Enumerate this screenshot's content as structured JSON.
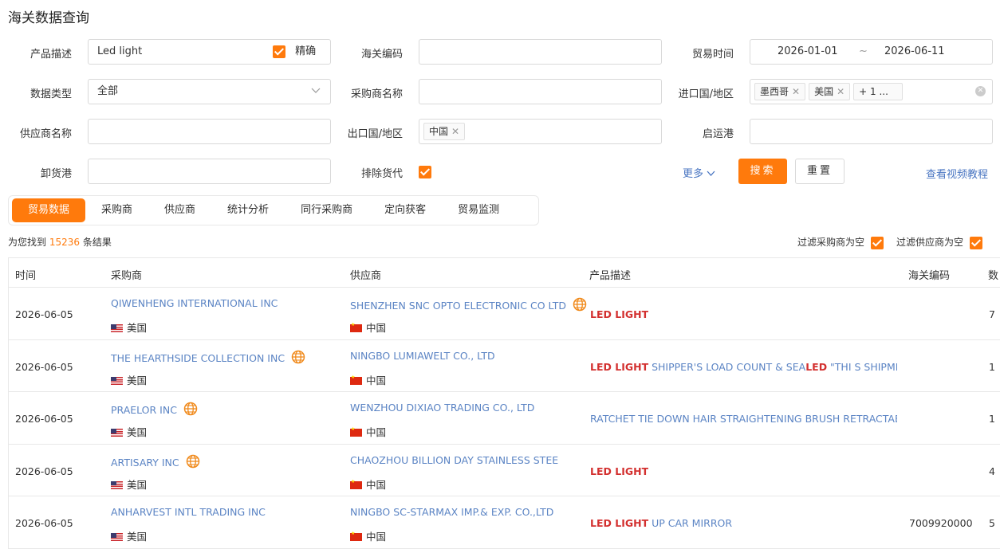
{
  "page_title": "海关数据查询",
  "form": {
    "product_desc": {
      "label": "产品描述",
      "value": "Led light",
      "exact_label": "精确"
    },
    "hs_code": {
      "label": "海关编码",
      "value": ""
    },
    "trade_time": {
      "label": "贸易时间",
      "start": "2026-01-01",
      "separator": "~",
      "end": "2026-06-11"
    },
    "data_type": {
      "label": "数据类型",
      "value": "全部"
    },
    "buyer_name": {
      "label": "采购商名称",
      "value": ""
    },
    "import_country": {
      "label": "进口国/地区",
      "tags": [
        "墨西哥",
        "美国"
      ],
      "more": "+ 1 ..."
    },
    "supplier_name": {
      "label": "供应商名称",
      "value": ""
    },
    "export_country": {
      "label": "出口国/地区",
      "tags": [
        "中国"
      ]
    },
    "origin_port": {
      "label": "启运港",
      "value": ""
    },
    "discharge_port": {
      "label": "卸货港",
      "value": ""
    },
    "exclude_forwarder": {
      "label": "排除货代"
    },
    "more_label": "更多",
    "search_label": "搜索",
    "reset_label": "重置",
    "video_tutorial": "查看视频教程"
  },
  "tabs": [
    "贸易数据",
    "采购商",
    "供应商",
    "统计分析",
    "同行采购商",
    "定向获客",
    "贸易监测"
  ],
  "result": {
    "prefix": "为您找到",
    "count": "15236",
    "suffix": "条结果"
  },
  "filters": {
    "buyer_empty": "过滤采购商为空",
    "supplier_empty": "过滤供应商为空"
  },
  "table": {
    "headers": {
      "time": "时间",
      "buyer": "采购商",
      "supplier": "供应商",
      "desc": "产品描述",
      "hs": "海关编码",
      "extra": "数"
    },
    "rows": [
      {
        "date": "2026-06-05",
        "buyer": "QIWENHENG INTERNATIONAL INC",
        "buyer_country": "美国",
        "buyer_globe": false,
        "supplier": "SHENZHEN SNC OPTO ELECTRONIC CO LTD",
        "supplier_country": "中国",
        "supplier_globe": true,
        "desc_hl": "LED LIGHT",
        "desc_rest": "",
        "hs": "",
        "qty": "7"
      },
      {
        "date": "2026-06-05",
        "buyer": "THE HEARTHSIDE COLLECTION INC",
        "buyer_country": "美国",
        "buyer_globe": true,
        "supplier": "NINGBO LUMIAWELT CO., LTD",
        "supplier_country": "中国",
        "supplier_globe": false,
        "desc_hl": "LED LIGHT",
        "desc_rest": " SHIPPER'S LOAD COUNT & SEA",
        "desc_hl2": "LED",
        "desc_rest2": " \"THI S SHIPMENT...",
        "hs": "",
        "qty": "1"
      },
      {
        "date": "2026-06-05",
        "buyer": "PRAELOR INC",
        "buyer_country": "美国",
        "buyer_globe": true,
        "supplier": "WENZHOU DIXIAO TRADING CO., LTD",
        "supplier_country": "中国",
        "supplier_globe": false,
        "desc_hl": "",
        "desc_rest": "RATCHET TIE DOWN HAIR STRAIGHTENING BRUSH RETRACTABL...",
        "hs": "",
        "qty": "1"
      },
      {
        "date": "2026-06-05",
        "buyer": "ARTISARY INC",
        "buyer_country": "美国",
        "buyer_globe": true,
        "supplier": "CHAOZHOU BILLION DAY STAINLESS STEE",
        "supplier_country": "中国",
        "supplier_globe": false,
        "desc_hl": "LED LIGHT",
        "desc_rest": "",
        "hs": "",
        "qty": "4"
      },
      {
        "date": "2026-06-05",
        "buyer": "ANHARVEST INTL TRADING INC",
        "buyer_country": "美国",
        "buyer_globe": false,
        "supplier": "NINGBO SC-STARMAX IMP.& EXP. CO.,LTD",
        "supplier_country": "中国",
        "supplier_globe": false,
        "desc_hl": "LED LIGHT",
        "desc_rest": " UP CAR MIRROR",
        "hs": "7009920000",
        "qty": "5"
      }
    ]
  }
}
